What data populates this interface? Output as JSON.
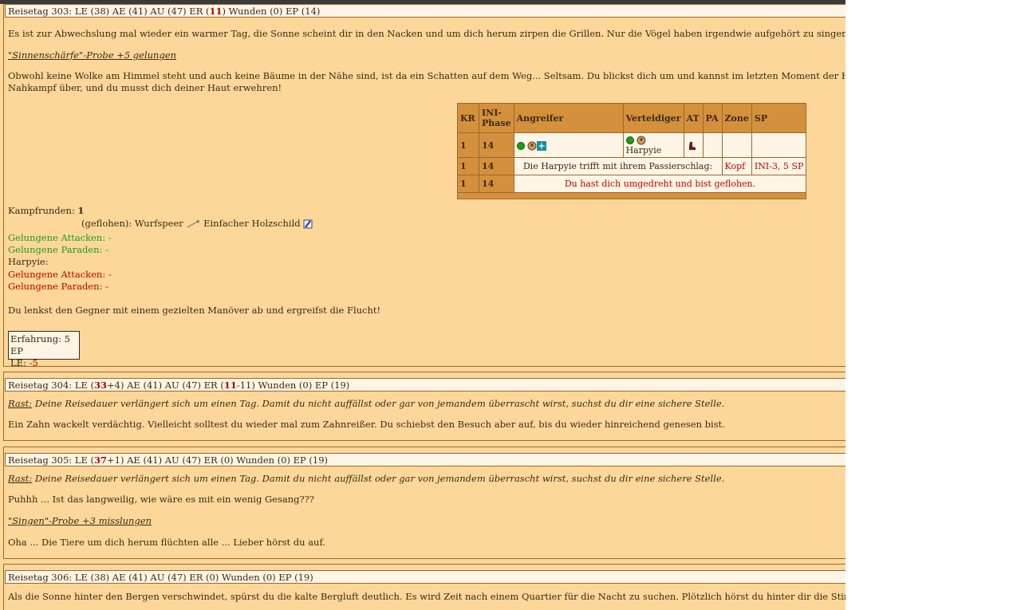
{
  "day303": {
    "head": {
      "a": "Reisetag 303: LE (38) AE (41) AU (47) ER (",
      "er": "11",
      "b": ") Wunden (0) EP (14)"
    },
    "text1": "Es ist zur Abwechslung mal wieder ein warmer Tag, die Sonne scheint dir in den Nacken und um dich herum zirpen die Grillen. Nur die Vögel haben irgendwie aufgehört zu singen...",
    "probe": "\"Sinnenschärfe\"-Probe +5 gelungen",
    "text2a": "Obwohl keine Wolke am Himmel steht und auch keine Bäume in der Nähe sind, ist da ein Schatten auf dem Weg... Seltsam. Du blickst dich um und kannst im letzten Moment der Harpyie ausweichen, die dich v",
    "text2b": "Nahkampf über, und du musst dich deiner Haut erwehren!",
    "table": {
      "headers": [
        "KR",
        "INI-",
        "Phase",
        "Angreifer",
        "Verteidiger",
        "AT",
        "PA",
        "Zone",
        "SP"
      ],
      "r1": {
        "kr": "1",
        "ini": "14",
        "defender": "Harpyie"
      },
      "r2": {
        "kr": "1",
        "ini": "14",
        "text": "Die Harpyie trifft mit ihrem Passierschlag:",
        "zone": "Kopf",
        "sp": "INI-3, 5 SP"
      },
      "r3": {
        "kr": "1",
        "ini": "14",
        "text": "Du hast dich umgedreht und bist geflohen."
      }
    },
    "kampfrunden_label": "Kampfrunden: ",
    "kampfrunden_value": "1",
    "weapons": "(geflohen): Wurfspeer",
    "shield": "Einfacher Holzschild",
    "att1": "Gelungene Attacken: -",
    "par1": "Gelungene Paraden: -",
    "enemy": "Harpyie:",
    "att2": "Gelungene Attacken: -",
    "par2": "Gelungene Paraden: -",
    "flight": "Du lenkst den Gegner mit einem gezielten Manöver ab und ergreifst die Flucht!",
    "exp": "Erfahrung: 5 EP",
    "le_label": "LE: ",
    "le_value": "-5"
  },
  "day304": {
    "head": {
      "a": "Reisetag 304: LE (",
      "le": "33",
      "b": "+4) AE (41) AU (47) ER (",
      "er": "11",
      "c": "-11) Wunden (0) EP (19)"
    },
    "rast_label": "Rast:",
    "rast_text": " Deine Reisedauer verlängert sich um einen Tag. Damit du nicht auffällst oder gar von jemandem überrascht wirst, suchst du dir eine sichere Stelle.",
    "text": "Ein Zahn wackelt verdächtig. Vielleicht solltest du wieder mal zum Zahnreißer. Du schiebst den Besuch aber auf, bis du wieder hinreichend genesen bist."
  },
  "day305": {
    "head": {
      "a": "Reisetag 305: LE (",
      "le": "37",
      "b": "+1) AE (41) AU (47) ER (0) Wunden (0) EP (19)"
    },
    "rast_label": "Rast:",
    "rast_text": " Deine Reisedauer verlängert sich um einen Tag. Damit du nicht auffällst oder gar von jemandem überrascht wirst, suchst du dir eine sichere Stelle.",
    "text1": "Puhhh ... Ist das langweilig, wie wäre es mit ein wenig Gesang???",
    "probe": "\"Singen\"-Probe +3 misslungen",
    "text2": "Oha ... Die Tiere um dich herum flüchten alle ... Lieber hörst du auf."
  },
  "day306": {
    "head": "Reisetag 306: LE (38) AE (41) AU (47) ER (0) Wunden (0) EP (19)",
    "text": "Als die Sonne hinter den Bergen verschwindet, spürst du die kalte Bergluft deutlich. Es wird Zeit nach einem Quartier für die Nacht zu suchen. Plötzlich hörst du hinter dir die Stimme eines Zwergen, der dich ve"
  },
  "colors": {
    "background": "#fdd79a",
    "header_bg": "#fff5e6",
    "table_head": "#d4903d",
    "red": "#c00000",
    "green": "#1f9a1f"
  }
}
